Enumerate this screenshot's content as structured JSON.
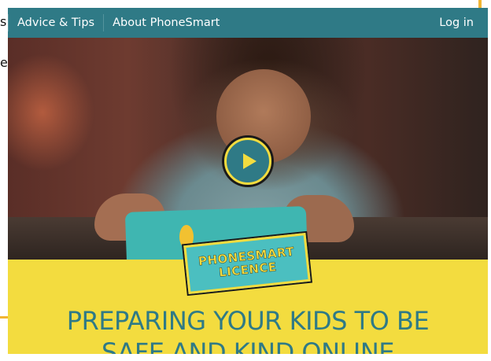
{
  "nav": {
    "items": [
      {
        "label": "Advice & Tips"
      },
      {
        "label": "About PhoneSmart"
      }
    ],
    "login_label": "Log in"
  },
  "edge_text": [
    "s",
    "e",
    "·",
    "·"
  ],
  "hero": {
    "badge_line1": "PHONESMART",
    "badge_line2": "LICENCE"
  },
  "headline": {
    "line1": "PREPARING YOUR KIDS TO BE",
    "line2": "SAFE AND KIND ONLINE"
  },
  "colors": {
    "nav_bg": "#2f7a86",
    "accent_yellow": "#f3dc3f",
    "teal_text": "#2f7a86",
    "badge_bg": "#4bbfc0"
  },
  "icons": {
    "play": "play-icon"
  }
}
